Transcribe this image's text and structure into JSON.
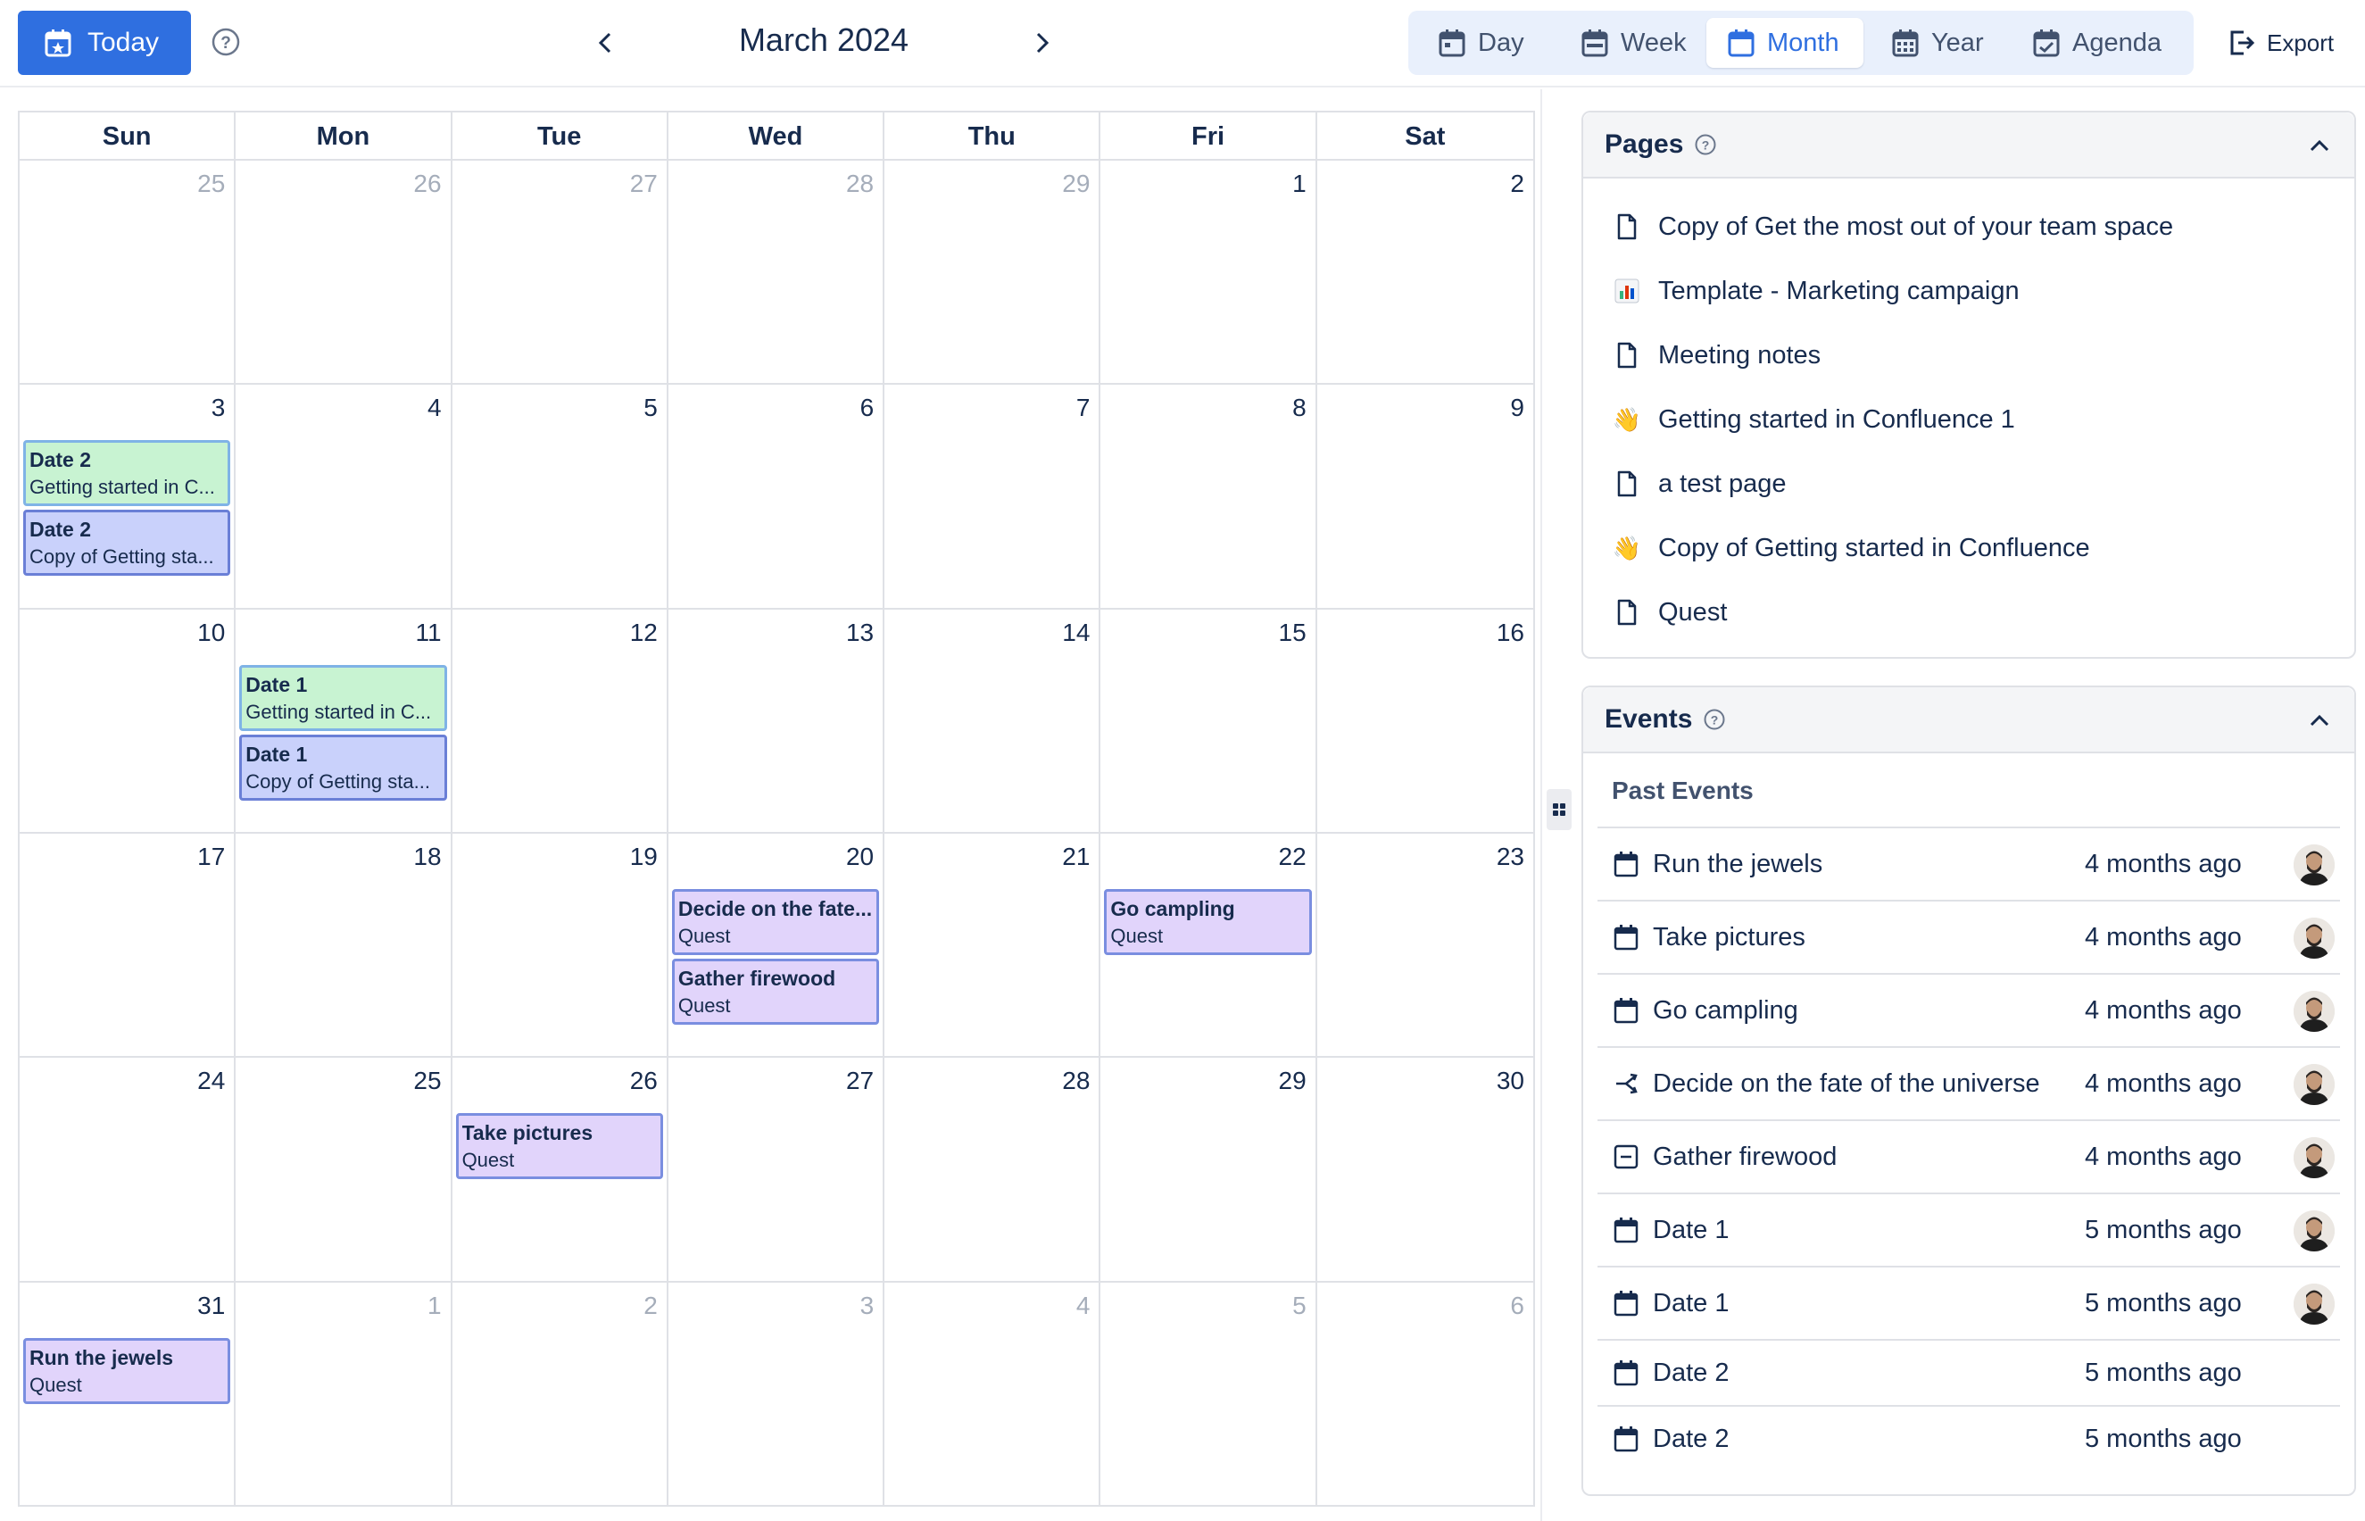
{
  "toolbar": {
    "today_label": "Today",
    "month_title": "March 2024",
    "views": [
      {
        "label": "Day",
        "icon": "calendar-day-icon"
      },
      {
        "label": "Week",
        "icon": "calendar-week-icon"
      },
      {
        "label": "Month",
        "icon": "calendar-month-icon",
        "active": true
      },
      {
        "label": "Year",
        "icon": "calendar-year-icon"
      },
      {
        "label": "Agenda",
        "icon": "calendar-agenda-icon"
      }
    ],
    "export_label": "Export",
    "accent_color": "#2f6fe0"
  },
  "calendar": {
    "weekdays": [
      "Sun",
      "Mon",
      "Tue",
      "Wed",
      "Thu",
      "Fri",
      "Sat"
    ],
    "days": [
      {
        "n": "25",
        "muted": true
      },
      {
        "n": "26",
        "muted": true
      },
      {
        "n": "27",
        "muted": true
      },
      {
        "n": "28",
        "muted": true
      },
      {
        "n": "29",
        "muted": true
      },
      {
        "n": "1"
      },
      {
        "n": "2"
      },
      {
        "n": "3",
        "events": [
          {
            "title": "Date 2",
            "sub": "Getting started in C...",
            "color": "green"
          },
          {
            "title": "Date 2",
            "sub": "Copy of Getting sta...",
            "color": "blue"
          }
        ]
      },
      {
        "n": "4"
      },
      {
        "n": "5"
      },
      {
        "n": "6"
      },
      {
        "n": "7"
      },
      {
        "n": "8"
      },
      {
        "n": "9"
      },
      {
        "n": "10"
      },
      {
        "n": "11",
        "events": [
          {
            "title": "Date 1",
            "sub": "Getting started in C...",
            "color": "green"
          },
          {
            "title": "Date 1",
            "sub": "Copy of Getting sta...",
            "color": "blue"
          }
        ]
      },
      {
        "n": "12"
      },
      {
        "n": "13"
      },
      {
        "n": "14"
      },
      {
        "n": "15"
      },
      {
        "n": "16"
      },
      {
        "n": "17"
      },
      {
        "n": "18"
      },
      {
        "n": "19"
      },
      {
        "n": "20",
        "events": [
          {
            "title": "Decide on the fate...",
            "sub": "Quest",
            "color": "purple"
          },
          {
            "title": "Gather firewood",
            "sub": "Quest",
            "color": "purple"
          }
        ]
      },
      {
        "n": "21"
      },
      {
        "n": "22",
        "events": [
          {
            "title": "Go campling",
            "sub": "Quest",
            "color": "purple"
          }
        ]
      },
      {
        "n": "23"
      },
      {
        "n": "24"
      },
      {
        "n": "25"
      },
      {
        "n": "26",
        "events": [
          {
            "title": "Take pictures",
            "sub": "Quest",
            "color": "purple"
          }
        ]
      },
      {
        "n": "27"
      },
      {
        "n": "28"
      },
      {
        "n": "29"
      },
      {
        "n": "30"
      },
      {
        "n": "31",
        "events": [
          {
            "title": "Run the jewels",
            "sub": "Quest",
            "color": "purple"
          }
        ]
      },
      {
        "n": "1",
        "muted": true
      },
      {
        "n": "2",
        "muted": true
      },
      {
        "n": "3",
        "muted": true
      },
      {
        "n": "4",
        "muted": true
      },
      {
        "n": "5",
        "muted": true
      },
      {
        "n": "6",
        "muted": true
      }
    ]
  },
  "pages_panel": {
    "title": "Pages",
    "items": [
      {
        "label": "Copy of Get the most out of your team space",
        "icon": "page"
      },
      {
        "label": "Template - Marketing campaign",
        "icon": "chart"
      },
      {
        "label": "Meeting notes",
        "icon": "page"
      },
      {
        "label": "Getting started in Confluence 1",
        "icon": "wave"
      },
      {
        "label": "a test page",
        "icon": "page"
      },
      {
        "label": "Copy of Getting started in Confluence",
        "icon": "wave"
      },
      {
        "label": "Quest",
        "icon": "page"
      }
    ]
  },
  "events_panel": {
    "title": "Events",
    "section_title": "Past Events",
    "items": [
      {
        "name": "Run the jewels",
        "when": "4 months ago",
        "icon": "calendar",
        "avatar": true
      },
      {
        "name": "Take pictures",
        "when": "4 months ago",
        "icon": "calendar",
        "avatar": true
      },
      {
        "name": "Go campling",
        "when": "4 months ago",
        "icon": "calendar",
        "avatar": true
      },
      {
        "name": "Decide on the fate of the universe",
        "when": "4 months ago",
        "icon": "decision",
        "avatar": true
      },
      {
        "name": "Gather firewood",
        "when": "4 months ago",
        "icon": "task",
        "avatar": true
      },
      {
        "name": "Date 1",
        "when": "5 months ago",
        "icon": "calendar",
        "avatar": true
      },
      {
        "name": "Date 1",
        "when": "5 months ago",
        "icon": "calendar",
        "avatar": true
      },
      {
        "name": "Date 2",
        "when": "5 months ago",
        "icon": "calendar",
        "avatar": false
      },
      {
        "name": "Date 2",
        "when": "5 months ago",
        "icon": "calendar",
        "avatar": false
      }
    ]
  }
}
